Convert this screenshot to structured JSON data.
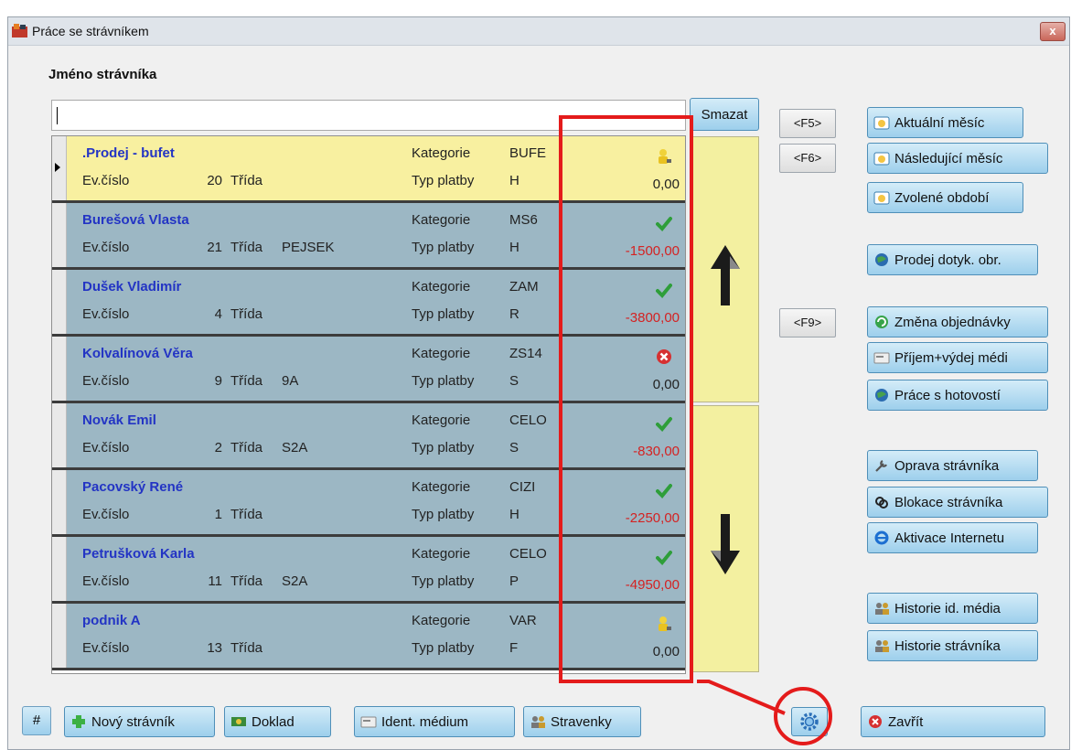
{
  "window": {
    "title": "Práce se strávníkem",
    "close_label": "x"
  },
  "search": {
    "label": "Jméno strávníka",
    "value": "",
    "clear_label": "Smazat"
  },
  "fkeys": {
    "f5": "<F5>",
    "f6": "<F6>",
    "f9": "<F9>"
  },
  "side_buttons": {
    "current_month": "Aktuální měsíc",
    "next_month": "Následující měsíc",
    "selected_period": "Zvolené období",
    "touch_sale": "Prodej dotyk. obr.",
    "order_change": "Změna objednávky",
    "media_io": "Příjem+výdej médi",
    "cash_work": "Práce s hotovostí",
    "edit_diner": "Oprava strávníka",
    "block_diner": "Blokace strávníka",
    "activate_internet": "Aktivace Internetu",
    "history_media": "Historie id. média",
    "history_diner": "Historie strávníka"
  },
  "bottom_buttons": {
    "hash": "#",
    "new_diner": "Nový strávník",
    "receipt": "Doklad",
    "ident_media": "Ident. médium",
    "meal_tickets": "Stravenky",
    "close": "Zavřít"
  },
  "table_labels": {
    "ev_cislo": "Ev.číslo",
    "trida": "Třída",
    "kategorie": "Kategorie",
    "typ_platby": "Typ platby"
  },
  "rows": [
    {
      "name": ".Prodej - bufet",
      "ev": "20",
      "class": "",
      "category": "BUFE",
      "pay": "H",
      "amount": "0,00",
      "status": "person-yellow",
      "selected": true
    },
    {
      "name": "Burešová Vlasta",
      "ev": "21",
      "class": "PEJSEK",
      "category": "MS6",
      "pay": "H",
      "amount": "-1500,00",
      "status": "check-green",
      "selected": false
    },
    {
      "name": "Dušek Vladimír",
      "ev": "4",
      "class": "",
      "category": "ZAM",
      "pay": "R",
      "amount": "-3800,00",
      "status": "check-green",
      "selected": false
    },
    {
      "name": "Kolvalínová Věra",
      "ev": "9",
      "class": "9A",
      "category": "ZS14",
      "pay": "S",
      "amount": "0,00",
      "status": "cross-red",
      "selected": false
    },
    {
      "name": "Novák Emil",
      "ev": "2",
      "class": "S2A",
      "category": "CELO",
      "pay": "S",
      "amount": "-830,00",
      "status": "check-green",
      "selected": false
    },
    {
      "name": "Pacovský René",
      "ev": "1",
      "class": "",
      "category": "CIZI",
      "pay": "H",
      "amount": "-2250,00",
      "status": "check-green",
      "selected": false
    },
    {
      "name": "Petrušková Karla",
      "ev": "11",
      "class": "S2A",
      "category": "CELO",
      "pay": "P",
      "amount": "-4950,00",
      "status": "check-green",
      "selected": false
    },
    {
      "name": "podnik A",
      "ev": "13",
      "class": "",
      "category": "VAR",
      "pay": "F",
      "amount": "0,00",
      "status": "person-yellow",
      "selected": false
    }
  ],
  "colors": {
    "selected_row": "#f8f0a0",
    "row": "#9cb7c4",
    "name": "#2334c4",
    "negative": "#d42222",
    "highlight": "#e41b1b"
  }
}
